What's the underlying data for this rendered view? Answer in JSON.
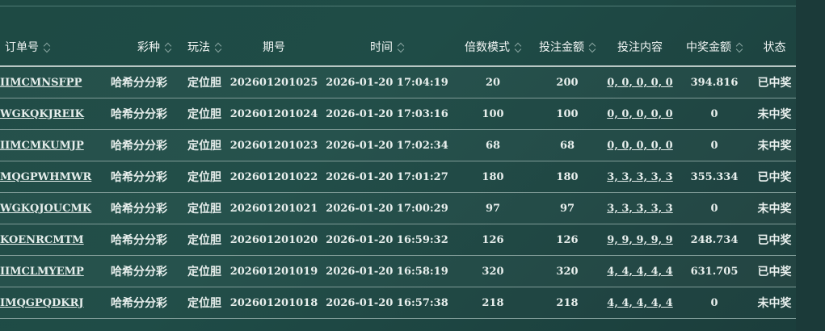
{
  "columns": [
    {
      "label": "订单号",
      "sortable": true
    },
    {
      "label": "彩种",
      "sortable": true
    },
    {
      "label": "玩法",
      "sortable": true
    },
    {
      "label": "期号",
      "sortable": false
    },
    {
      "label": "时间",
      "sortable": true
    },
    {
      "label": "倍数模式",
      "sortable": true
    },
    {
      "label": "投注金额",
      "sortable": true
    },
    {
      "label": "投注内容",
      "sortable": false
    },
    {
      "label": "中奖金额",
      "sortable": true
    },
    {
      "label": "状态",
      "sortable": false
    }
  ],
  "rows": [
    {
      "order": "IIMCMNSFPP",
      "lottery": "哈希分分彩",
      "play": "定位胆",
      "period": "202601201025",
      "time": "2026-01-20 17:04:19",
      "multiple": "20",
      "amount": "200",
      "content": "0, 0, 0, 0, 0",
      "win": "394.816",
      "status": "已中奖"
    },
    {
      "order": "WGKQKJREIK",
      "lottery": "哈希分分彩",
      "play": "定位胆",
      "period": "202601201024",
      "time": "2026-01-20 17:03:16",
      "multiple": "100",
      "amount": "100",
      "content": "0, 0, 0, 0, 0",
      "win": "0",
      "status": "未中奖"
    },
    {
      "order": "IIMCMKUMJP",
      "lottery": "哈希分分彩",
      "play": "定位胆",
      "period": "202601201023",
      "time": "2026-01-20 17:02:34",
      "multiple": "68",
      "amount": "68",
      "content": "0, 0, 0, 0, 0",
      "win": "0",
      "status": "未中奖"
    },
    {
      "order": "MQGPWHMWR",
      "lottery": "哈希分分彩",
      "play": "定位胆",
      "period": "202601201022",
      "time": "2026-01-20 17:01:27",
      "multiple": "180",
      "amount": "180",
      "content": "3, 3, 3, 3, 3",
      "win": "355.334",
      "status": "已中奖"
    },
    {
      "order": "WGKQJOUCMK",
      "lottery": "哈希分分彩",
      "play": "定位胆",
      "period": "202601201021",
      "time": "2026-01-20 17:00:29",
      "multiple": "97",
      "amount": "97",
      "content": "3, 3, 3, 3, 3",
      "win": "0",
      "status": "未中奖"
    },
    {
      "order": "KOENRCMTM",
      "lottery": "哈希分分彩",
      "play": "定位胆",
      "period": "202601201020",
      "time": "2026-01-20 16:59:32",
      "multiple": "126",
      "amount": "126",
      "content": "9, 9, 9, 9, 9",
      "win": "248.734",
      "status": "已中奖"
    },
    {
      "order": "IIMCLMYEMP",
      "lottery": "哈希分分彩",
      "play": "定位胆",
      "period": "202601201019",
      "time": "2026-01-20 16:58:19",
      "multiple": "320",
      "amount": "320",
      "content": "4, 4, 4, 4, 4",
      "win": "631.705",
      "status": "已中奖"
    },
    {
      "order": "IMQGPQDKRJ",
      "lottery": "哈希分分彩",
      "play": "定位胆",
      "period": "202601201018",
      "time": "2026-01-20 16:57:38",
      "multiple": "218",
      "amount": "218",
      "content": "4, 4, 4, 4, 4",
      "win": "0",
      "status": "未中奖"
    }
  ]
}
